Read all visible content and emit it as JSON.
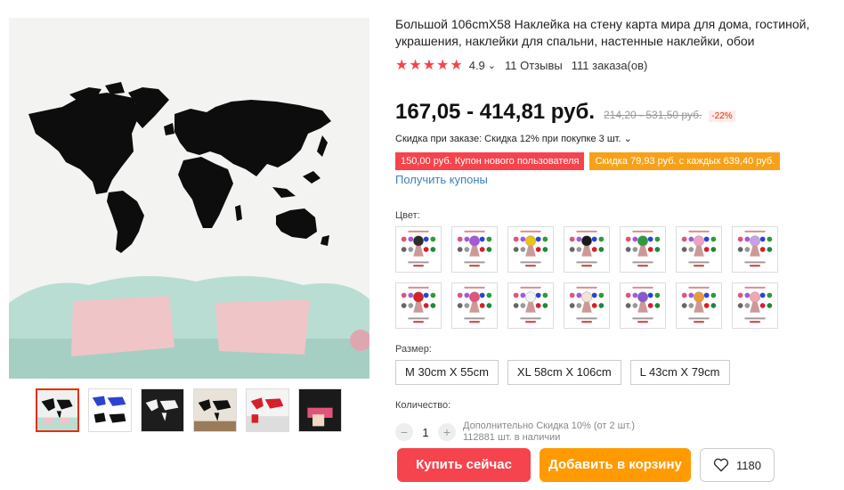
{
  "product": {
    "title": "Большой 106cmX58 Наклейка на стену карта мира для дома, гостиной, украшения, наклейки для спальни, настенные наклейки, обои",
    "stars": "★★★★★",
    "rating": "4.9",
    "rating_caret": "⌄",
    "reviews": "11 Отзывы",
    "orders": "111 заказа(ов)"
  },
  "price": {
    "current": "167,05 - 414,81 руб.",
    "old": "214,20 - 531,50 руб.",
    "discount": "-22%"
  },
  "promos": {
    "bulk": "Скидка при заказе: Скидка 12% при покупке 3 шт. ⌄",
    "coupon_new_user": "150,00 руб. Купон нового пользователя",
    "coupon_store": "Скидка 79,93 руб. с каждых 639,40 руб.",
    "get_coupons": "Получить купоны"
  },
  "color": {
    "label": "Цвет:",
    "swatch_colors": [
      "#2d2d2d",
      "#a25ad8",
      "#e7c21a",
      "#1b1b1b",
      "#2e9a3c",
      "#f0a2c4",
      "#c7a0e6",
      "#d6202a",
      "#e0547a",
      "#f3f3f3",
      "#f2e4cf",
      "#8a58c9",
      "#e99a3a",
      "#f4a7b0"
    ]
  },
  "size": {
    "label": "Размер:",
    "options": [
      "M 30cm X 55cm",
      "XL 58cm X 106cm",
      "L 43cm X 79cm"
    ]
  },
  "quantity": {
    "label": "Количество:",
    "minus": "−",
    "value": "1",
    "plus": "+",
    "extra_discount": "Дополнительно Скидка 10% (от 2 шт.)",
    "stock": "112881 шт. в наличии"
  },
  "actions": {
    "buy_now": "Купить сейчас",
    "add_to_cart": "Добавить в корзину",
    "wishlist_count": "1180"
  },
  "icons": {
    "heart": "heart-icon"
  }
}
